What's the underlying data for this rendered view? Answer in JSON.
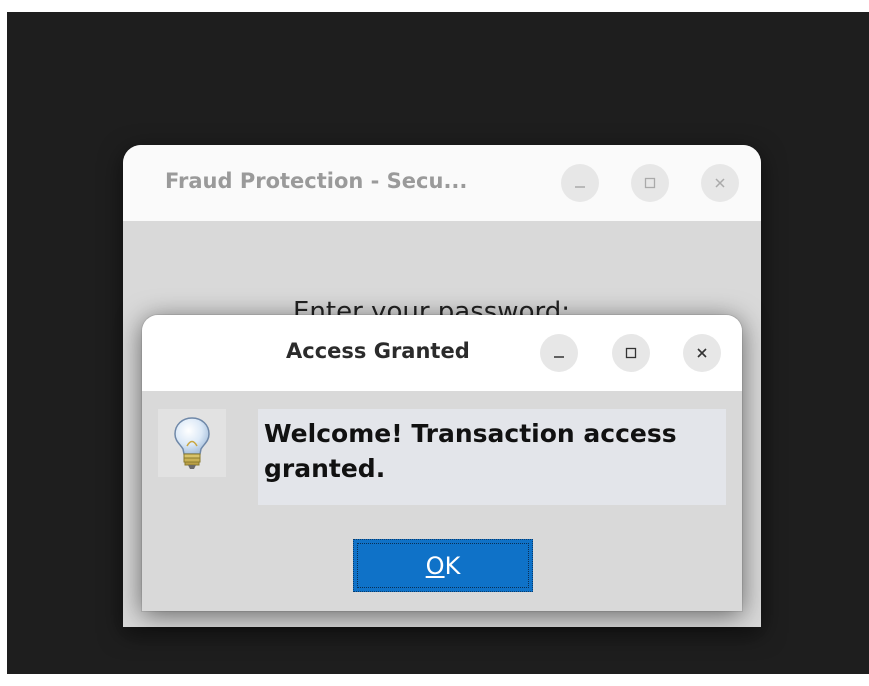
{
  "main_window": {
    "title": "Fraud Protection - Secu...",
    "prompt": "Enter your password:"
  },
  "dialog": {
    "title": "Access Granted",
    "message_line1": "Welcome! Transaction access",
    "message_line2": "granted.",
    "ok_mnemonic": "O",
    "ok_rest": "K",
    "icon": "lightbulb-info-icon"
  },
  "window_controls": [
    "minimize-icon",
    "maximize-icon",
    "close-icon"
  ],
  "colors": {
    "desktop": "#1e1e1e",
    "ok_button": "#0f72c8"
  }
}
